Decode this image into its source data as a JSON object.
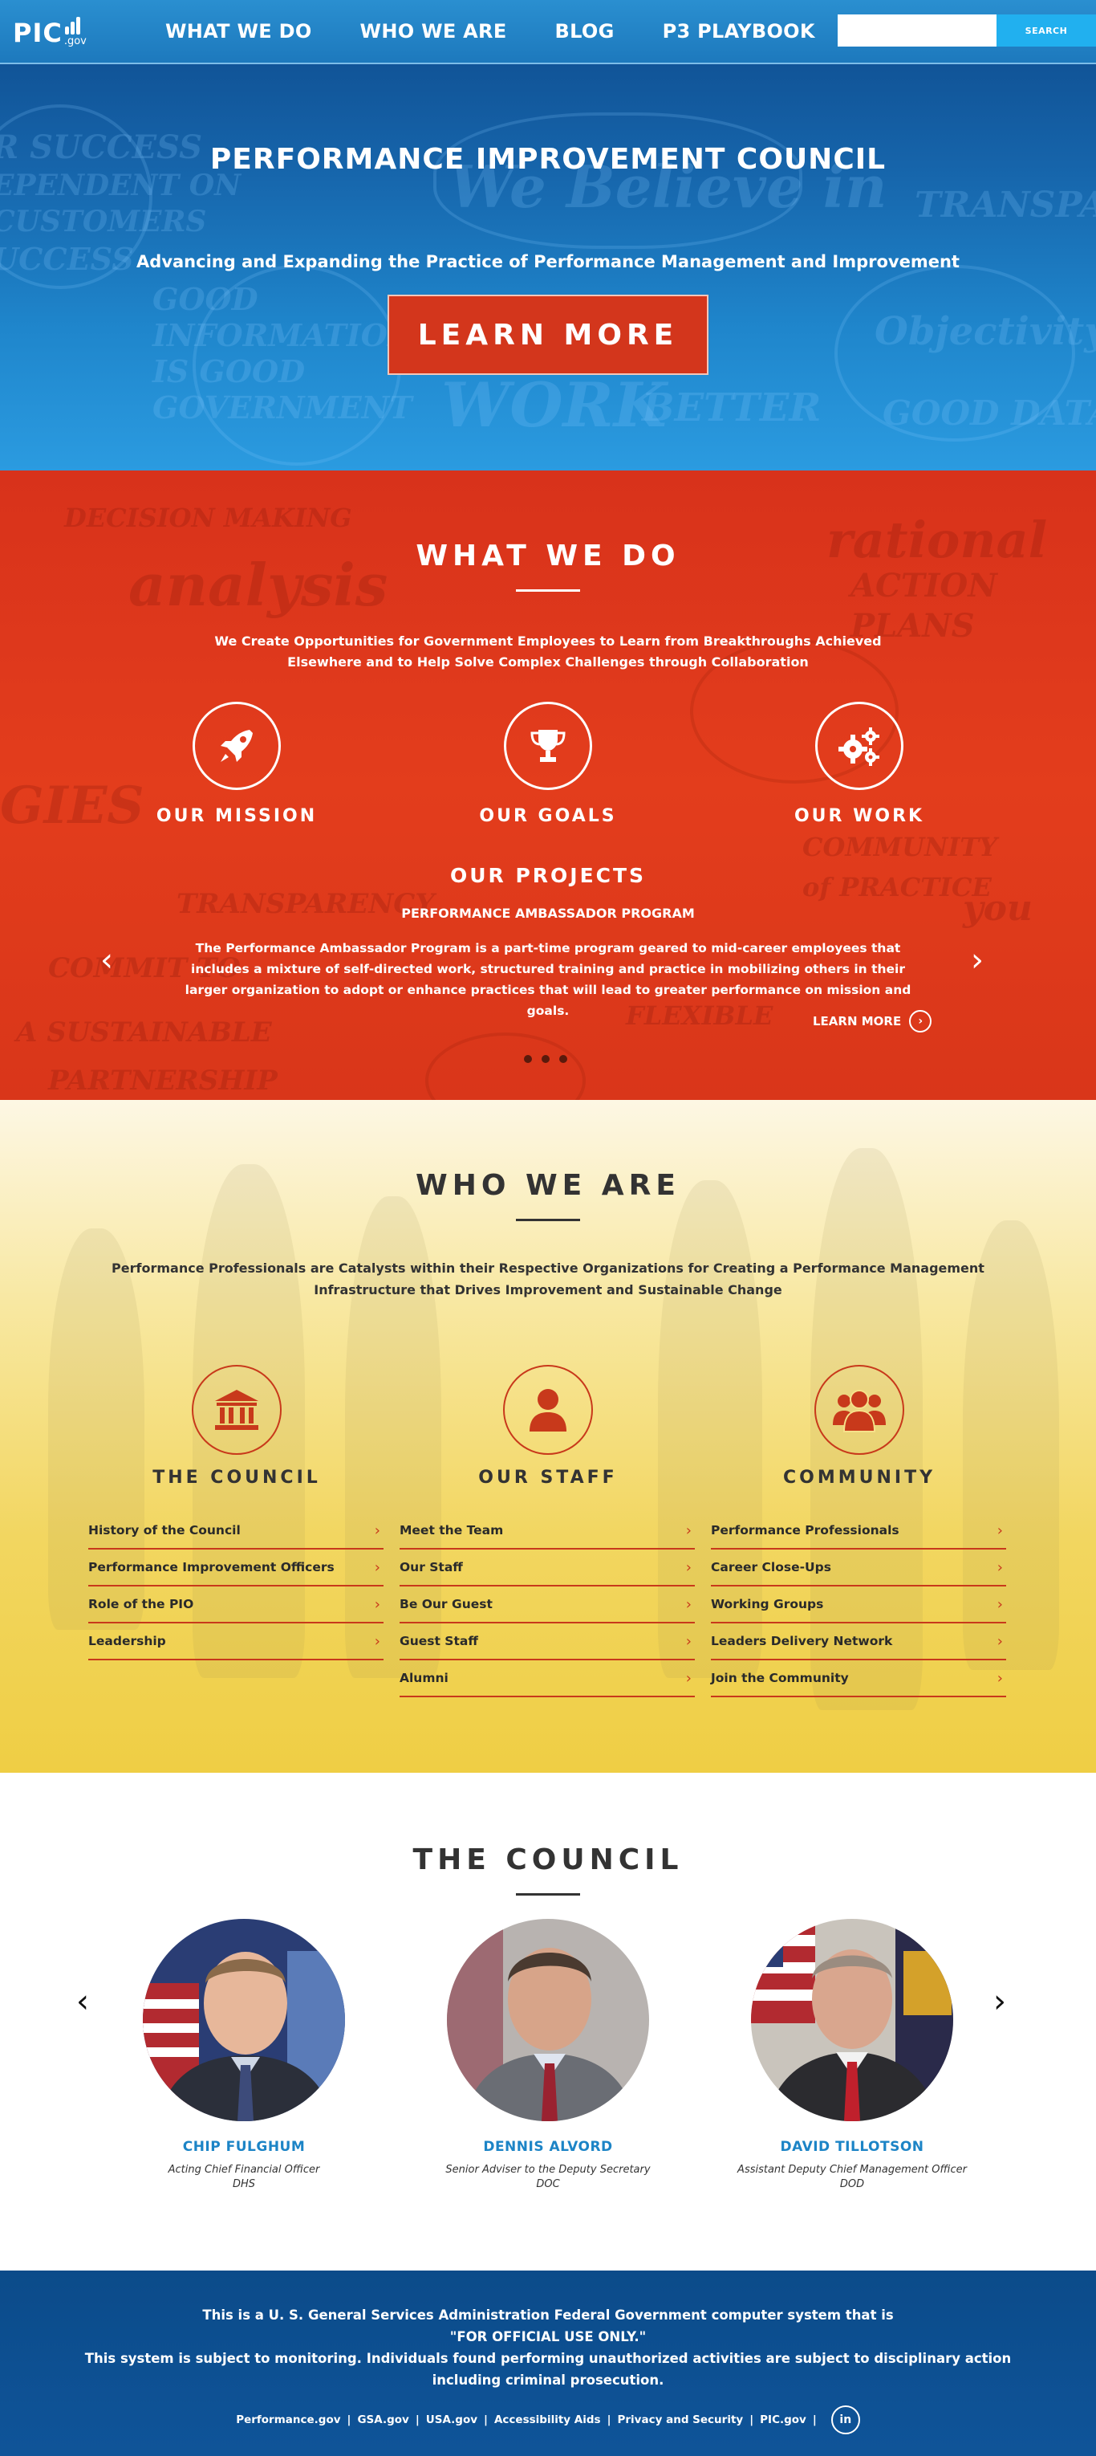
{
  "header": {
    "logo_text": "PIC",
    "logo_suffix": ".gov",
    "nav": [
      "WHAT WE DO",
      "WHO WE ARE",
      "BLOG",
      "P3 PLAYBOOK"
    ],
    "search_placeholder": "",
    "search_button": "SEARCH",
    "colors": {
      "bar": "#1d79bd",
      "search_button": "#21b0ef"
    }
  },
  "hero": {
    "title": "PERFORMANCE IMPROVEMENT COUNCIL",
    "subtitle": "Advancing and Expanding the Practice of Performance Management and Improvement",
    "button": "LEARN MORE",
    "colors": {
      "button": "#d3361c"
    }
  },
  "what_we_do": {
    "title": "WHAT WE DO",
    "description": "We Create Opportunities for Government Employees to Learn from Breakthroughs Achieved Elsewhere and to Help Solve Complex Challenges through Collaboration",
    "items": [
      {
        "label": "OUR MISSION",
        "icon": "rocket-icon"
      },
      {
        "label": "OUR GOALS",
        "icon": "trophy-icon"
      },
      {
        "label": "OUR WORK",
        "icon": "gears-icon"
      }
    ],
    "projects_title": "OUR PROJECTS",
    "project_name": "PERFORMANCE AMBASSADOR PROGRAM",
    "project_description": "The Performance Ambassador Program is a part-time program geared to mid-career employees that includes a mixture of self-directed work, structured training and practice in mobilizing others in their larger organization to adopt or enhance practices that will lead to greater performance on mission and goals.",
    "learn_more": "LEARN MORE",
    "prev_arrow": "‹",
    "next_arrow": "›",
    "slide_count": 3,
    "colors": {
      "background": "#e03a1c"
    }
  },
  "who_we_are": {
    "title": "WHO WE ARE",
    "description": "Performance Professionals are Catalysts within their Respective Organizations for Creating a Performance Management Infrastructure that Drives Improvement and Sustainable Change",
    "columns": [
      {
        "title": "THE COUNCIL",
        "icon": "building-icon",
        "links": [
          "History of the Council",
          "Performance Improvement Officers",
          "Role of the PIO",
          "Leadership"
        ]
      },
      {
        "title": "OUR STAFF",
        "icon": "person-icon",
        "links": [
          "Meet the Team",
          "Our Staff",
          "Be Our Guest",
          "Guest Staff",
          "Alumni"
        ]
      },
      {
        "title": "COMMUNITY",
        "icon": "group-icon",
        "links": [
          "Performance Professionals",
          "Career Close-Ups",
          "Working Groups",
          "Leaders Delivery Network",
          "Join the Community"
        ]
      }
    ],
    "colors": {
      "accent": "#c8391b",
      "background": "#f2d660"
    }
  },
  "council": {
    "title": "THE COUNCIL",
    "members": [
      {
        "name": "CHIP FULGHUM",
        "role": "Acting Chief Financial Officer",
        "agency": "DHS"
      },
      {
        "name": "DENNIS ALVORD",
        "role": "Senior Adviser to the Deputy Secretary",
        "agency": "DOC"
      },
      {
        "name": "DAVID TILLOTSON",
        "role": "Assistant Deputy Chief Management Officer",
        "agency": "DOD"
      }
    ],
    "prev_arrow": "‹",
    "next_arrow": "›",
    "colors": {
      "name": "#1c84c6"
    }
  },
  "footer": {
    "lines": [
      "This is a U. S. General Services Administration Federal Government computer system that is",
      "\"FOR OFFICIAL USE ONLY.\"",
      "This system is subject to monitoring. Individuals found performing unauthorized activities are subject to disciplinary action",
      "including criminal prosecution."
    ],
    "links": [
      "Performance.gov",
      "GSA.gov",
      "USA.gov",
      "Accessibility Aids",
      "Privacy and Security",
      "PIC.gov"
    ],
    "social": "in",
    "colors": {
      "background": "#0b4b8a"
    }
  }
}
